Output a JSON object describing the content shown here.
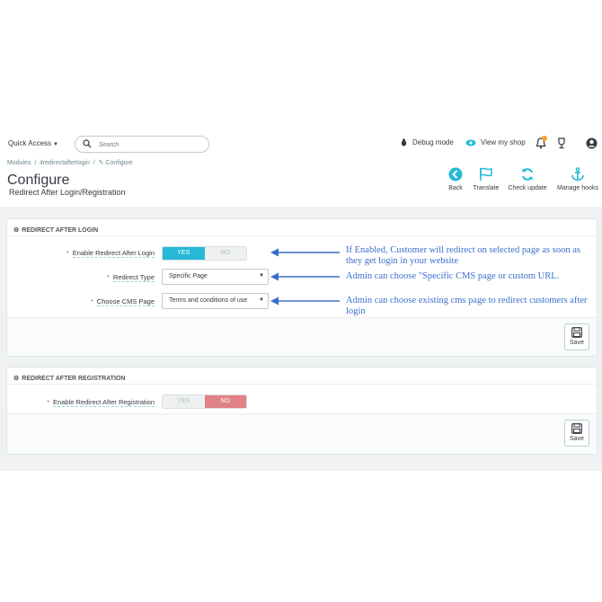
{
  "topbar": {
    "quick_access": "Quick Access",
    "search_placeholder": "Search",
    "debug_mode": "Debug mode",
    "view_shop": "View my shop"
  },
  "breadcrumb": {
    "modules": "Modules",
    "sep": "/",
    "module": "itredirectafterlogin",
    "configure": "Configure"
  },
  "header": {
    "title": "Configure",
    "subtitle": "Redirect After Login/Registration"
  },
  "toolbar": {
    "back": "Back",
    "translate": "Translate",
    "check_update": "Check update",
    "manage_hooks": "Manage hooks"
  },
  "panel_login": {
    "heading": "REDIRECT AFTER LOGIN",
    "enable_label": "Enable Redirect After Login",
    "yes": "YES",
    "no": "NO",
    "redirect_type_label": "Redirect Type",
    "redirect_type_value": "Specific Page",
    "cms_label": "Choose CMS Page",
    "cms_value": "Terms and conditions of use",
    "save": "Save"
  },
  "panel_registration": {
    "heading": "REDIRECT AFTER REGISTRATION",
    "enable_label": "Enable Redirect After Registration",
    "yes": "YES",
    "no": "NO",
    "save": "Save"
  },
  "notes": {
    "note1_line1": "If Enabled, Customer will redirect on selected page as soon as",
    "note1_line2": "they get login in your website",
    "note2": "Admin can choose \"Specific CMS page or custom URL.",
    "note3_line1": "Admin can choose existing cms page to redirect customers after",
    "note3_line2": "login"
  },
  "colors": {
    "accent": "#25b9d7",
    "no_active": "#e08185",
    "note_blue": "#3a6fc9"
  }
}
